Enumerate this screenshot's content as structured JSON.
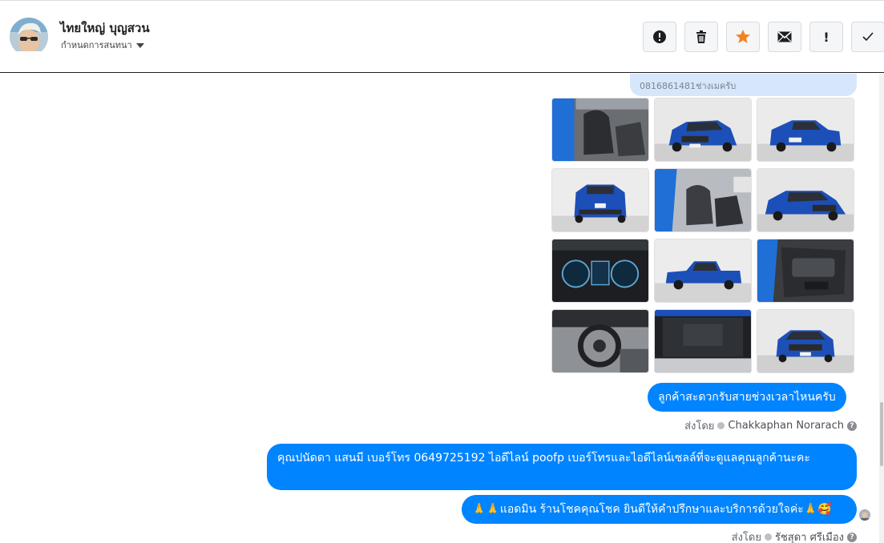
{
  "header": {
    "contact_name": "ไทยใหญ่ บุญสวน",
    "conversation_label": "กำหนดการสนทนา",
    "toolbar": [
      {
        "icon": "alert-circle-icon"
      },
      {
        "icon": "trash-icon"
      },
      {
        "icon": "star-icon",
        "color": "#f5821f"
      },
      {
        "icon": "envelope-icon"
      },
      {
        "icon": "exclamation-icon",
        "label": "!"
      },
      {
        "icon": "checkmark-icon"
      }
    ]
  },
  "messages": {
    "phone_text": "0816861481ช่างเมครับ",
    "photos": [
      "car-interior-seats",
      "blue-pickup-front",
      "blue-pickup-rear-angle",
      "blue-pickup-rear",
      "car-interior-side",
      "blue-pickup-front-angle",
      "dashboard-gauges",
      "blue-pickup-side",
      "door-panel",
      "steering-wheel",
      "engine-bay",
      "blue-pickup-front-2"
    ],
    "msg1": "ลูกค้าสะดวกรับสายช่วงเวลาไหนครับ",
    "sent_by_label_1": "ส่งโดย",
    "agent_1": "Chakkaphan Norarach",
    "msg2": "คุณปนัดดา แสนมี   เบอร์โทร 0649725192  ไอดีไลน์ poofp   เบอร์โทรและไอดีไลน์เซลล์ที่จะดูแลคุณลูกค้านะคะ",
    "msg3": "🙏🙏แอดมิน ร้านโชคคุณโชค ยินดีให้คำปรึกษาและบริการด้วยใจค่ะ🙏🥰",
    "sent_by_label_2": "ส่งโดย",
    "agent_2": "รัชสุดา ศรีเมือง"
  },
  "colors": {
    "bubble_blue": "#0084ff",
    "phone_bubble": "#d6e6fb",
    "star": "#f5821f"
  }
}
